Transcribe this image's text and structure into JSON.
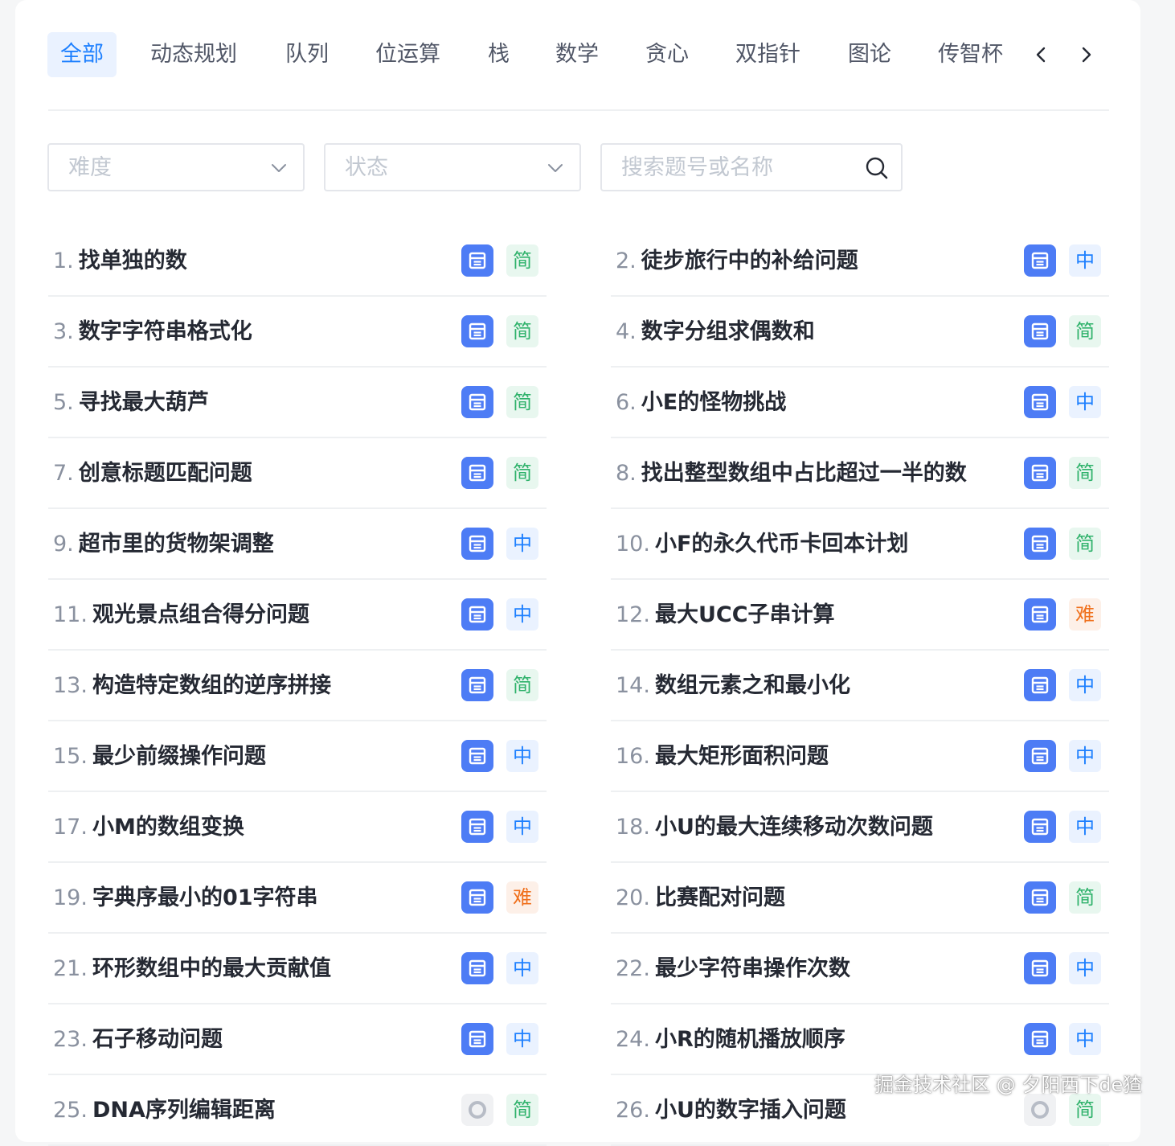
{
  "tabs": [
    "全部",
    "动态规划",
    "队列",
    "位运算",
    "栈",
    "数学",
    "贪心",
    "双指针",
    "图论",
    "传智杯"
  ],
  "filters": {
    "difficulty_placeholder": "难度",
    "status_placeholder": "状态",
    "search_placeholder": "搜索题号或名称"
  },
  "problems": [
    {
      "num": "1.",
      "title": "找单独的数",
      "level": "简"
    },
    {
      "num": "2.",
      "title": "徒步旅行中的补给问题",
      "level": "中"
    },
    {
      "num": "3.",
      "title": "数字字符串格式化",
      "level": "简"
    },
    {
      "num": "4.",
      "title": "数字分组求偶数和",
      "level": "简"
    },
    {
      "num": "5.",
      "title": "寻找最大葫芦",
      "level": "简"
    },
    {
      "num": "6.",
      "title": "小E的怪物挑战",
      "level": "中"
    },
    {
      "num": "7.",
      "title": "创意标题匹配问题",
      "level": "简"
    },
    {
      "num": "8.",
      "title": "找出整型数组中占比超过一半的数",
      "level": "简"
    },
    {
      "num": "9.",
      "title": "超市里的货物架调整",
      "level": "中"
    },
    {
      "num": "10.",
      "title": "小F的永久代币卡回本计划",
      "level": "简"
    },
    {
      "num": "11.",
      "title": "观光景点组合得分问题",
      "level": "中"
    },
    {
      "num": "12.",
      "title": "最大UCC子串计算",
      "level": "难"
    },
    {
      "num": "13.",
      "title": "构造特定数组的逆序拼接",
      "level": "简"
    },
    {
      "num": "14.",
      "title": "数组元素之和最小化",
      "level": "中"
    },
    {
      "num": "15.",
      "title": "最少前缀操作问题",
      "level": "中"
    },
    {
      "num": "16.",
      "title": "最大矩形面积问题",
      "level": "中"
    },
    {
      "num": "17.",
      "title": "小M的数组变换",
      "level": "中"
    },
    {
      "num": "18.",
      "title": "小U的最大连续移动次数问题",
      "level": "中"
    },
    {
      "num": "19.",
      "title": "字典序最小的01字符串",
      "level": "难"
    },
    {
      "num": "20.",
      "title": "比赛配对问题",
      "level": "简"
    },
    {
      "num": "21.",
      "title": "环形数组中的最大贡献值",
      "level": "中"
    },
    {
      "num": "22.",
      "title": "最少字符串操作次数",
      "level": "中"
    },
    {
      "num": "23.",
      "title": "石子移动问题",
      "level": "中"
    },
    {
      "num": "24.",
      "title": "小R的随机播放顺序",
      "level": "中"
    },
    {
      "num": "25.",
      "title": "DNA序列编辑距离",
      "level": "简",
      "icon": "gray"
    },
    {
      "num": "26.",
      "title": "小U的数字插入问题",
      "level": "简",
      "icon": "gray"
    }
  ],
  "watermark": "掘金技术社区 @ 夕阳西下de猹",
  "colors": {
    "accent": "#1e80ff",
    "easy": "#2fb26b",
    "medium": "#1e80ff",
    "hard": "#f0701c",
    "note_icon": "#4d7cf5"
  }
}
